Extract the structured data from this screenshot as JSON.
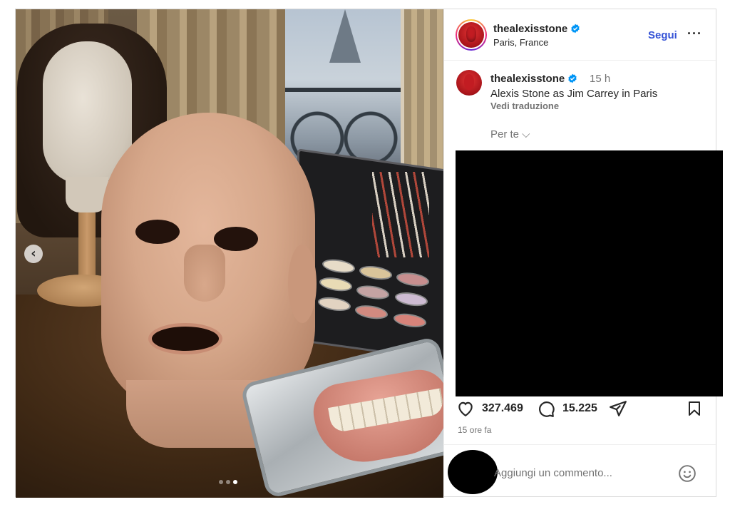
{
  "post": {
    "carousel": {
      "total_slides": 3,
      "active_slide": 3
    },
    "header": {
      "username": "thealexisstone",
      "location": "Paris, France",
      "follow_label": "Segui",
      "more_label": "···"
    },
    "caption": {
      "username": "thealexisstone",
      "time": "15 h",
      "text": "Alexis Stone as Jim Carrey in Paris",
      "translate_label": "Vedi traduzione",
      "for_you_label": "Per te ⌵"
    },
    "stats": {
      "likes": "327.469",
      "comments": "15.225",
      "posted": "15 ore fa"
    },
    "comment_box": {
      "placeholder": "Aggiungi un commento..."
    },
    "colors": {
      "follow_blue": "#3553d6",
      "verified_blue": "#0095f6",
      "text_primary": "#262626",
      "text_secondary": "#737373"
    },
    "icons": [
      "chevron-left-icon",
      "verified-badge-icon",
      "more-icon",
      "heart-icon",
      "comment-icon",
      "share-icon",
      "bookmark-icon",
      "emoji-icon"
    ]
  }
}
